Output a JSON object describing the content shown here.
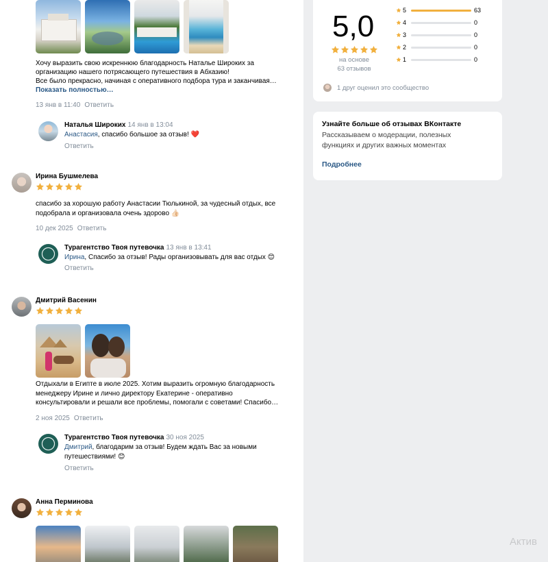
{
  "colors": {
    "accent": "#2a5885",
    "star": "#f1b03e",
    "muted": "#818c99",
    "bg": "#edeef0"
  },
  "reviews": [
    {
      "text_lines": [
        "Хочу выразить свою искреннюю благодарность Наталье Широких за",
        "организацию нашего потрясающего путешествия в Абхазию!",
        "Все было прекрасно, начиная с оперативного подбора тура и заканчивая…"
      ],
      "more": "Показать полностью…",
      "date": "13 янв в 11:40",
      "reply_label": "Ответить",
      "reply": {
        "author": "Наталья Широких",
        "date": "14 янв в 13:04",
        "mention": "Анастасия",
        "text": ", спасибо большое за отзыв! ❤️",
        "reply_label": "Ответить"
      }
    },
    {
      "name": "Ирина Бушмелева",
      "text_lines": [
        "спасибо за хорошую работу Анастасии Тюлькиной, за чудесный отдых, все",
        "подобрала и организовала очень здорово 👍🏻"
      ],
      "date": "10 дек 2025",
      "reply_label": "Ответить",
      "reply": {
        "author": "Турагентство Твоя путевочка",
        "date": "13 янв в 13:41",
        "mention": "Ирина",
        "text": ", Спасибо за отзыв! Рады организовывать для вас отдых 😊",
        "reply_label": "Ответить"
      }
    },
    {
      "name": "Дмитрий Васенин",
      "text_lines": [
        "Отдыхали в Египте в июле 2025. Хотим выразить огромную благодарность",
        "менеджеру Ирине и лично директору Екатерине - оперативно",
        "консультировали и решали все проблемы, помогали с советами! Спасибо…"
      ],
      "date": "2 ноя 2025",
      "reply_label": "Ответить",
      "reply": {
        "author": "Турагентство Твоя путевочка",
        "date": "30 ноя 2025",
        "mention": "Дмитрий",
        "text": ", благодарим за отзыв! Будем ждать Вас за новыми путешествиями! 😊",
        "reply_label": "Ответить"
      }
    },
    {
      "name": "Анна Перминова"
    }
  ],
  "summary": {
    "score": "5,0",
    "based_on": "на основе",
    "reviews_count": "63 отзывов",
    "stars_shown": 5,
    "breakdown": [
      {
        "label": "5",
        "count": "63",
        "fraction": 1.0
      },
      {
        "label": "4",
        "count": "0",
        "fraction": 0
      },
      {
        "label": "3",
        "count": "0",
        "fraction": 0
      },
      {
        "label": "2",
        "count": "0",
        "fraction": 0
      },
      {
        "label": "1",
        "count": "0",
        "fraction": 0
      }
    ],
    "friend_text": "1 друг оценил это сообщество"
  },
  "info_card": {
    "title": "Узнайте больше об отзывах ВКонтакте",
    "text_lines": [
      "Рассказываем о модерации, полезных",
      "функциях и других важных моментах"
    ],
    "link": "Подробнее"
  },
  "watermark": "Актив"
}
